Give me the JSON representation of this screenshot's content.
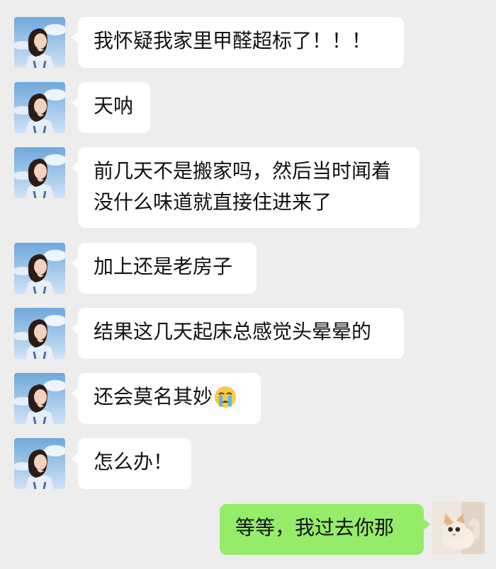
{
  "conversation": {
    "messages": [
      {
        "sender": "other",
        "lines": [
          "我怀疑我家里甲醛超标了！！！"
        ]
      },
      {
        "sender": "other",
        "lines": [
          "天呐"
        ]
      },
      {
        "sender": "other",
        "lines": [
          "前几天不是搬家吗，然后当时闻着",
          "没什么味道就直接住进来了"
        ]
      },
      {
        "sender": "other",
        "lines": [
          "加上还是老房子"
        ]
      },
      {
        "sender": "other",
        "lines": [
          "结果这几天起床总感觉头晕晕的"
        ]
      },
      {
        "sender": "other",
        "lines": [
          "还会莫名其妙"
        ],
        "emoji": "crying-face-emoji"
      },
      {
        "sender": "other",
        "lines": [
          "怎么办！"
        ]
      },
      {
        "sender": "self",
        "lines": [
          "等等，我过去你那"
        ]
      }
    ]
  },
  "colors": {
    "background": "#ededed",
    "other_bubble": "#ffffff",
    "self_bubble": "#95ec69"
  },
  "avatars": {
    "other": "woman-sky-avatar",
    "self": "kitten-avatar"
  }
}
